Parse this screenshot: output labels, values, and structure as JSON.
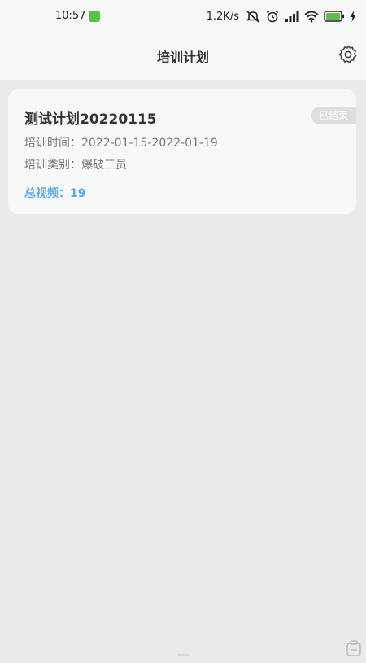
{
  "status_bar": {
    "time": "10:57",
    "net_speed": "1.2K/s",
    "icons": [
      "wechat-notification-icon",
      "mute-icon",
      "alarm-icon",
      "signal-icon",
      "wifi-icon",
      "battery-icon",
      "charging-icon"
    ],
    "colors": {
      "wechat": "#5dbf4b",
      "battery": "#5dbf4b"
    }
  },
  "header": {
    "title": "培训计划",
    "settings_icon": "gear-icon"
  },
  "plans": [
    {
      "title": "测试计划20220115",
      "status": "已结束",
      "time_label": "培训时间：",
      "time_value": "2022-01-15-2022-01-19",
      "category_label": "培训类别：",
      "category_value": "爆破三员",
      "video_label": "总视频：",
      "video_count": "19"
    }
  ],
  "colors": {
    "background": "#e8eaeb",
    "card": "#f7f8f8",
    "accent": "#5aa9e6",
    "badge": "#dcdedf"
  }
}
